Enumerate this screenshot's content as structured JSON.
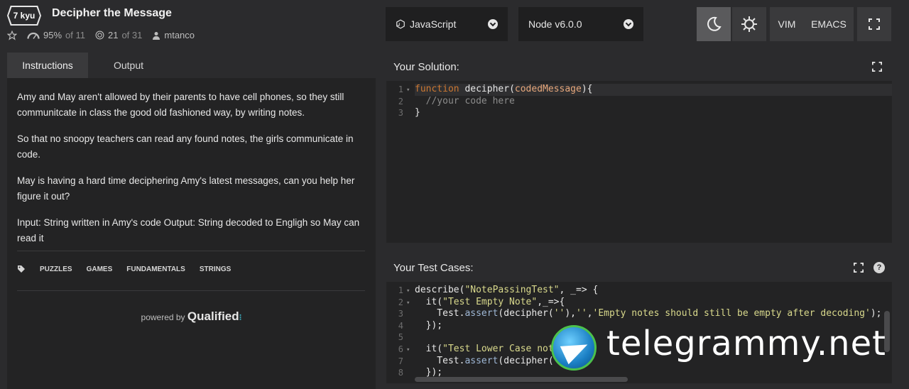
{
  "header": {
    "rank": "7 kyu",
    "title": "Decipher the Message",
    "stats": {
      "satisfaction": "95%",
      "satisfaction_of": "of 11",
      "completed": "21",
      "completed_of": "of 31",
      "author": "mtanco"
    }
  },
  "controls": {
    "language": "JavaScript",
    "runtime": "Node v6.0.0",
    "vim_label": "VIM",
    "emacs_label": "EMACS"
  },
  "left_panel": {
    "tabs": [
      {
        "label": "Instructions"
      },
      {
        "label": "Output"
      }
    ],
    "description": [
      "Amy and May aren't allowed by their parents to have cell phones, so they still communitcate in class the good old fashioned way, by writing notes.",
      "So that no snoopy teachers can read any found notes, the girls communicate in code.",
      "May is having a hard time deciphering Amy's latest messages, can you help her figure it out?",
      "Input: String written in Amy's code Output: String decoded to Engligh so May can read it"
    ],
    "tags": [
      "PUZZLES",
      "GAMES",
      "FUNDAMENTALS",
      "STRINGS"
    ],
    "powered_by": "powered by",
    "powered_brand": "Qualified"
  },
  "solution": {
    "title": "Your Solution:",
    "line_numbers": [
      "1",
      "2",
      "3"
    ]
  },
  "tests": {
    "title": "Your Test Cases:",
    "help": "?",
    "line_numbers": [
      "1",
      "2",
      "3",
      "4",
      "5",
      "6",
      "7",
      "8"
    ]
  },
  "watermark": {
    "text": "telegrammy.net"
  },
  "icons": {
    "star": "star-icon",
    "gauge": "gauge-icon",
    "target": "target-icon",
    "user": "user-icon",
    "moon": "moon-icon",
    "sun": "gear-icon",
    "expand": "expand-icon",
    "tag": "tag-icon"
  }
}
